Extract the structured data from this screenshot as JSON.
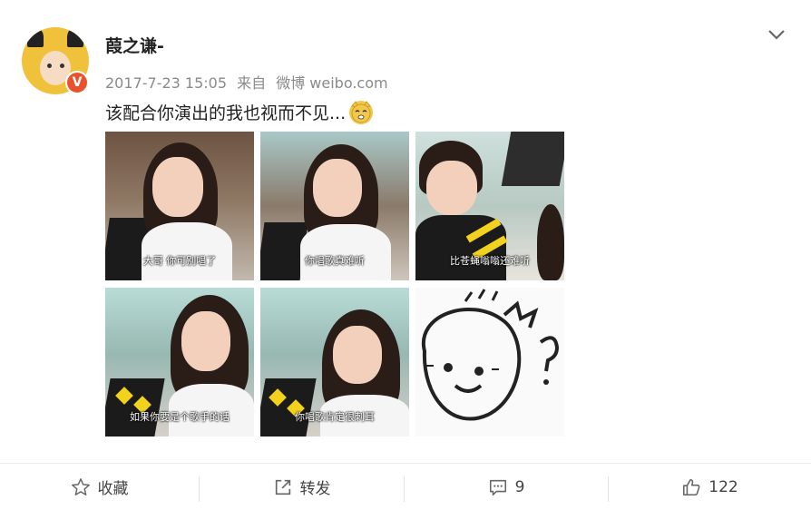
{
  "user": {
    "name": "葭之谦-",
    "timestamp": "2017-7-23 15:05",
    "source_prefix": "来自",
    "source": "微博 weibo.com"
  },
  "post": {
    "text": "该配合你演出的我也视而不见..."
  },
  "images": [
    {
      "caption": "大哥 你可别唱了"
    },
    {
      "caption": "你唱歌真难听"
    },
    {
      "caption": "比苍蝇嗡嗡还难听"
    },
    {
      "caption": "如果你要是个歌手的话"
    },
    {
      "caption": "你唱歌肯定很刺耳"
    },
    {
      "caption": ""
    }
  ],
  "actions": {
    "favorite_label": "收藏",
    "repost_label": "转发",
    "comment_count": "9",
    "like_count": "122"
  },
  "colors": {
    "badge": "#e8532d",
    "meta_text": "#8a8a8a"
  }
}
